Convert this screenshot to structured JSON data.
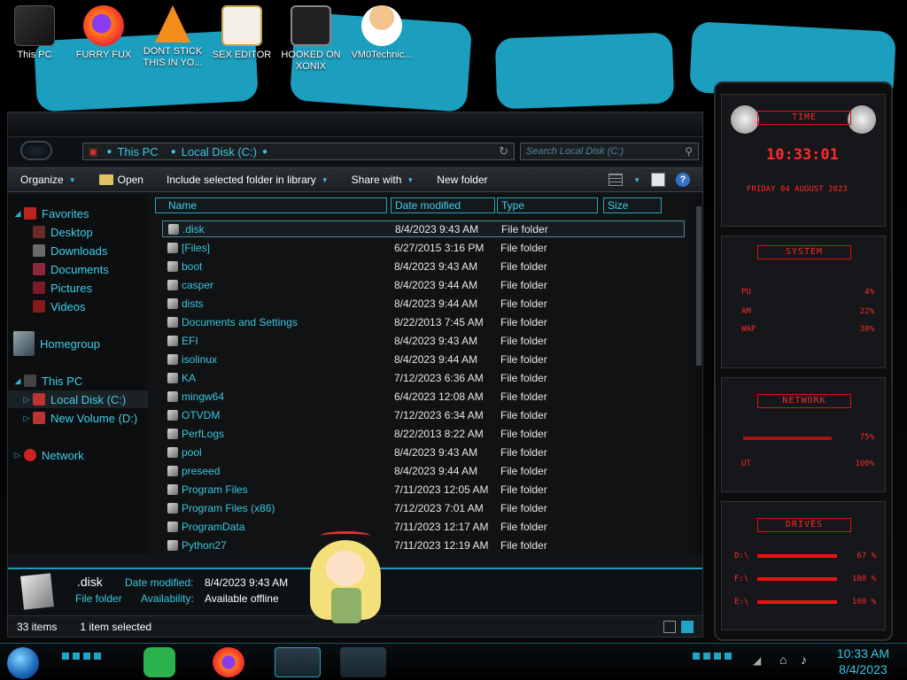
{
  "desktop": {
    "icons": [
      {
        "label": "This PC",
        "icon": "computer-icon"
      },
      {
        "label": "FURRY FUX",
        "icon": "firefox-icon"
      },
      {
        "label": "DONT STICK THIS IN YO...",
        "icon": "vlc-icon"
      },
      {
        "label": "SEX EDITOR",
        "icon": "hxd-editor-icon"
      },
      {
        "label": "HOOKED ON XONIX",
        "icon": "game-icon"
      },
      {
        "label": "VM0Technic...",
        "icon": "doctor-icon"
      }
    ]
  },
  "explorer": {
    "address": {
      "segments": [
        "This PC",
        "Local Disk (C:)"
      ]
    },
    "search": {
      "placeholder": "Search Local Disk (C:)"
    },
    "toolbar": {
      "organize": "Organize",
      "open": "Open",
      "include": "Include selected folder in library",
      "share": "Share with",
      "new_folder": "New folder"
    },
    "nav": {
      "favorites": "Favorites",
      "desktop": "Desktop",
      "downloads": "Downloads",
      "documents": "Documents",
      "pictures": "Pictures",
      "videos": "Videos",
      "homegroup": "Homegroup",
      "this_pc": "This PC",
      "local_disk": "Local Disk (C:)",
      "new_volume": "New Volume (D:)",
      "network": "Network"
    },
    "columns": {
      "name": "Name",
      "date": "Date modified",
      "type": "Type",
      "size": "Size"
    },
    "files": [
      {
        "name": ".disk",
        "date": "8/4/2023 9:43 AM",
        "type": "File folder"
      },
      {
        "name": "[Files]",
        "date": "6/27/2015 3:16 PM",
        "type": "File folder"
      },
      {
        "name": "boot",
        "date": "8/4/2023 9:43 AM",
        "type": "File folder"
      },
      {
        "name": "casper",
        "date": "8/4/2023 9:44 AM",
        "type": "File folder"
      },
      {
        "name": "dists",
        "date": "8/4/2023 9:44 AM",
        "type": "File folder"
      },
      {
        "name": "Documents and Settings",
        "date": "8/22/2013 7:45 AM",
        "type": "File folder"
      },
      {
        "name": "EFI",
        "date": "8/4/2023 9:43 AM",
        "type": "File folder"
      },
      {
        "name": "isolinux",
        "date": "8/4/2023 9:44 AM",
        "type": "File folder"
      },
      {
        "name": "KA",
        "date": "7/12/2023 6:36 AM",
        "type": "File folder"
      },
      {
        "name": "mingw64",
        "date": "6/4/2023 12:08 AM",
        "type": "File folder"
      },
      {
        "name": "OTVDM",
        "date": "7/12/2023 6:34 AM",
        "type": "File folder"
      },
      {
        "name": "PerfLogs",
        "date": "8/22/2013 8:22 AM",
        "type": "File folder"
      },
      {
        "name": "pool",
        "date": "8/4/2023 9:43 AM",
        "type": "File folder"
      },
      {
        "name": "preseed",
        "date": "8/4/2023 9:44 AM",
        "type": "File folder"
      },
      {
        "name": "Program Files",
        "date": "7/11/2023 12:05 AM",
        "type": "File folder"
      },
      {
        "name": "Program Files (x86)",
        "date": "7/12/2023 7:01 AM",
        "type": "File folder"
      },
      {
        "name": "ProgramData",
        "date": "7/11/2023 12:17 AM",
        "type": "File folder"
      },
      {
        "name": "Python27",
        "date": "7/11/2023 12:19 AM",
        "type": "File folder"
      }
    ],
    "details": {
      "name": ".disk",
      "kind": "File folder",
      "date_label": "Date modified:",
      "date_value": "8/4/2023 9:43 AM",
      "avail_label": "Availability:",
      "avail_value": "Available offline"
    },
    "status": {
      "count": "33 items",
      "selected": "1 item selected"
    }
  },
  "gadget": {
    "time_title": "TIME",
    "time": "10:33:01",
    "date": "FRIDAY 04 AUGUST 2023",
    "system_title": "SYSTEM",
    "system": [
      {
        "label": "PU",
        "value": "4%"
      },
      {
        "label": "AM",
        "value": "22%"
      },
      {
        "label": "WAP",
        "value": "30%"
      }
    ],
    "network_title": "NETWORK",
    "network": [
      {
        "label": "",
        "value": "75%"
      },
      {
        "label": "UT",
        "value": "100%"
      }
    ],
    "drives_title": "DRIVES",
    "drives": [
      {
        "label": "D:\\",
        "value": "67 %"
      },
      {
        "label": "F:\\",
        "value": "100 %"
      },
      {
        "label": "E:\\",
        "value": "100 %"
      }
    ]
  },
  "taskbar": {
    "time": "10:33 AM",
    "date": "8/4/2023"
  }
}
